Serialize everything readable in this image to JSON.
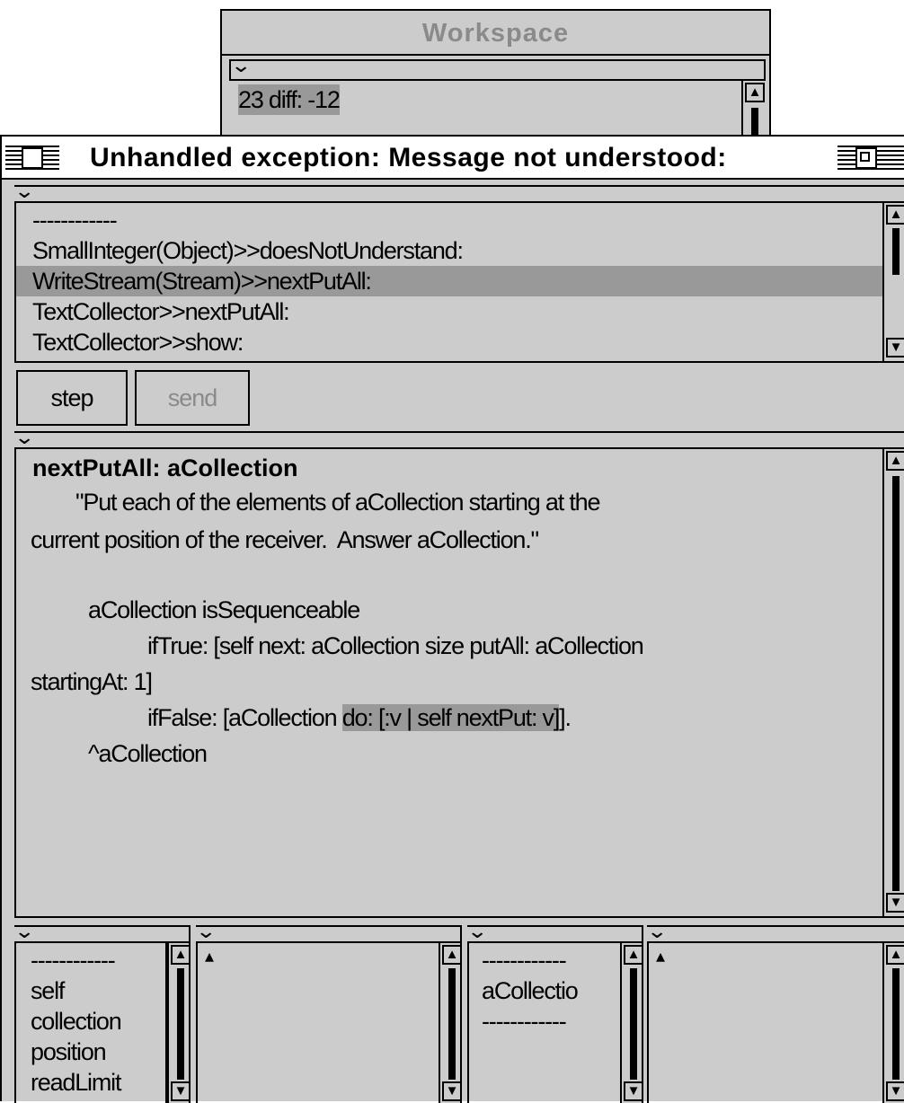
{
  "workspace": {
    "title": "Workspace",
    "content": "23 diff: -12"
  },
  "debugger": {
    "title": "Unhandled exception: Message not understood:",
    "stack": [
      "------------",
      "SmallInteger(Object)>>doesNotUnderstand:",
      "WriteStream(Stream)>>nextPutAll:",
      "TextCollector>>nextPutAll:",
      "TextCollector>>show:"
    ],
    "selected_stack_index": 2,
    "buttons": {
      "step": "step",
      "send": "send"
    },
    "code": {
      "header": "nextPutAll: aCollection",
      "line1": "\"Put each of the elements of aCollection starting at the",
      "line2": "current position of the receiver.  Answer aCollection.\"",
      "line3": "aCollection isSequenceable",
      "line4": "ifTrue: [self next: aCollection size putAll: aCollection",
      "line5": "startingAt: 1]",
      "line6a": "ifFalse: [aCollection ",
      "line6b": "do: [:v | self nextPut: v]",
      "line6c": "].",
      "line7": "^aCollection"
    },
    "receiver_vars": [
      "------------",
      "self",
      "collection",
      "position",
      "readLimit"
    ],
    "receiver_value": "▴",
    "context_vars": [
      "------------",
      "aCollectio",
      "------------"
    ],
    "context_value": "▴"
  }
}
